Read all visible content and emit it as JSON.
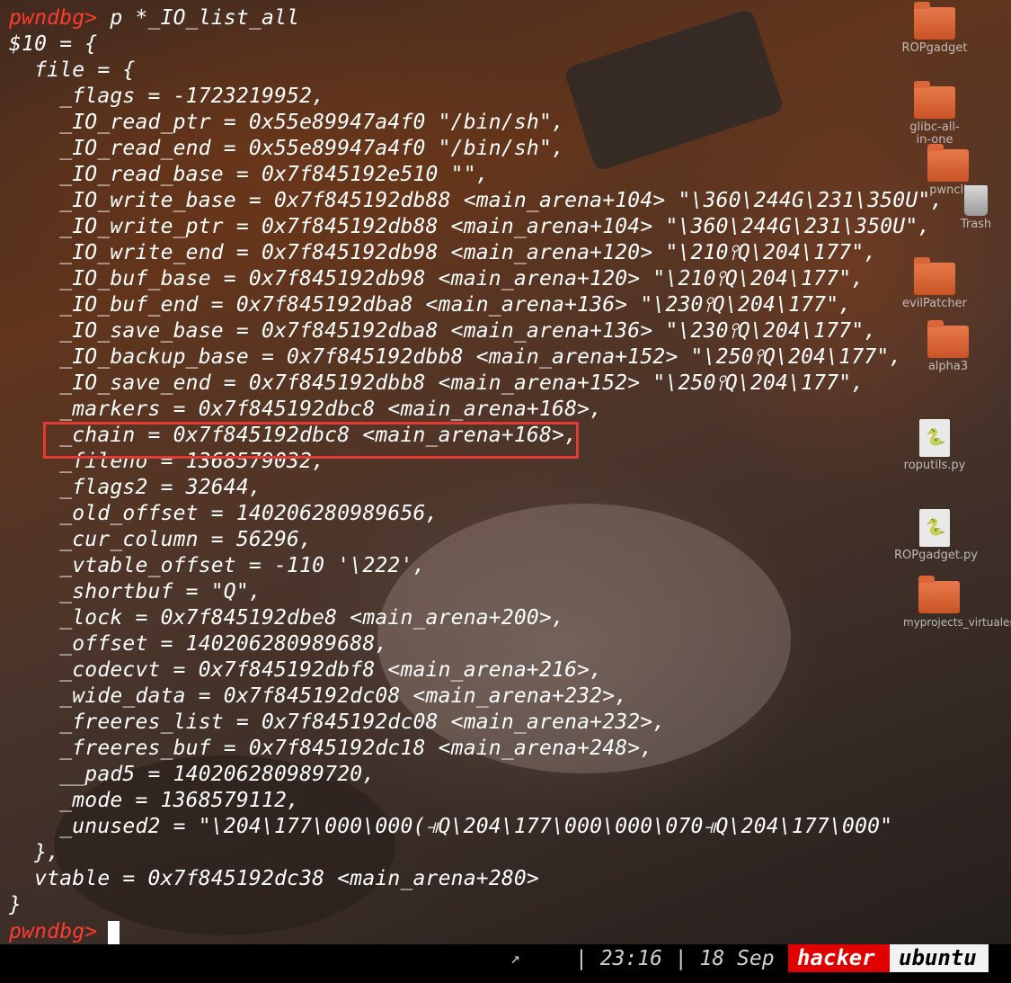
{
  "terminal": {
    "prompt": "pwndbg>",
    "command": " p *_IO_list_all",
    "lines": [
      "$10 = {",
      "  file = {",
      "    _flags = -1723219952,",
      "    _IO_read_ptr = 0x55e89947a4f0 \"/bin/sh\",",
      "    _IO_read_end = 0x55e89947a4f0 \"/bin/sh\",",
      "    _IO_read_base = 0x7f845192e510 \"\",",
      "    _IO_write_base = 0x7f845192db88 <main_arena+104> \"\\360\\244G\\231\\350U\",",
      "    _IO_write_ptr = 0x7f845192db88 <main_arena+104> \"\\360\\244G\\231\\350U\",",
      "    _IO_write_end = 0x7f845192db98 <main_arena+120> \"\\210⫯Q\\204\\177\",",
      "    _IO_buf_base = 0x7f845192db98 <main_arena+120> \"\\210⫯Q\\204\\177\",",
      "    _IO_buf_end = 0x7f845192dba8 <main_arena+136> \"\\230⫯Q\\204\\177\",",
      "    _IO_save_base = 0x7f845192dba8 <main_arena+136> \"\\230⫯Q\\204\\177\",",
      "    _IO_backup_base = 0x7f845192dbb8 <main_arena+152> \"\\250⫯Q\\204\\177\",",
      "    _IO_save_end = 0x7f845192dbb8 <main_arena+152> \"\\250⫯Q\\204\\177\",",
      "    _markers = 0x7f845192dbc8 <main_arena+168>,",
      "    _chain = 0x7f845192dbc8 <main_arena+168>,",
      "    _fileno = 1368579032,",
      "    _flags2 = 32644,",
      "    _old_offset = 140206280989656,",
      "    _cur_column = 56296,",
      "    _vtable_offset = -110 '\\222',",
      "    _shortbuf = \"Q\",",
      "    _lock = 0x7f845192dbe8 <main_arena+200>,",
      "    _offset = 140206280989688,",
      "    _codecvt = 0x7f845192dbf8 <main_arena+216>,",
      "    _wide_data = 0x7f845192dc08 <main_arena+232>,",
      "    _freeres_list = 0x7f845192dc08 <main_arena+232>,",
      "    _freeres_buf = 0x7f845192dc18 <main_arena+248>,",
      "    __pad5 = 140206280989720,",
      "    _mode = 1368579112,",
      "    _unused2 = \"\\204\\177\\000\\000(⫣Q\\204\\177\\000\\000\\070⫣Q\\204\\177\\000\"",
      "  },",
      "  vtable = 0x7f845192dc38 <main_arena+280>",
      "}"
    ],
    "final_prompt": "pwndbg>",
    "highlight_color": "#e53935"
  },
  "desktop": {
    "icons": [
      {
        "label": "ROPgadget",
        "kind": "folder"
      },
      {
        "label": "glibc-all-in-one",
        "kind": "folder"
      },
      {
        "label": "pwncli",
        "kind": "folder"
      },
      {
        "label": "Trash",
        "kind": "trash"
      },
      {
        "label": "evilPatcher",
        "kind": "folder"
      },
      {
        "label": "alpha3",
        "kind": "folder"
      },
      {
        "label": "roputils.py",
        "kind": "python"
      },
      {
        "label": "ROPgadget.py",
        "kind": "python"
      },
      {
        "label": "myprojects_virtualenv",
        "kind": "folder"
      }
    ]
  },
  "statusbar": {
    "arrow": "↗",
    "time_date": "| 23:16 | 18 Sep",
    "user": "hacker",
    "host": "ubuntu",
    "user_bg": "#e00000",
    "host_bg": "#f2f2f2"
  }
}
